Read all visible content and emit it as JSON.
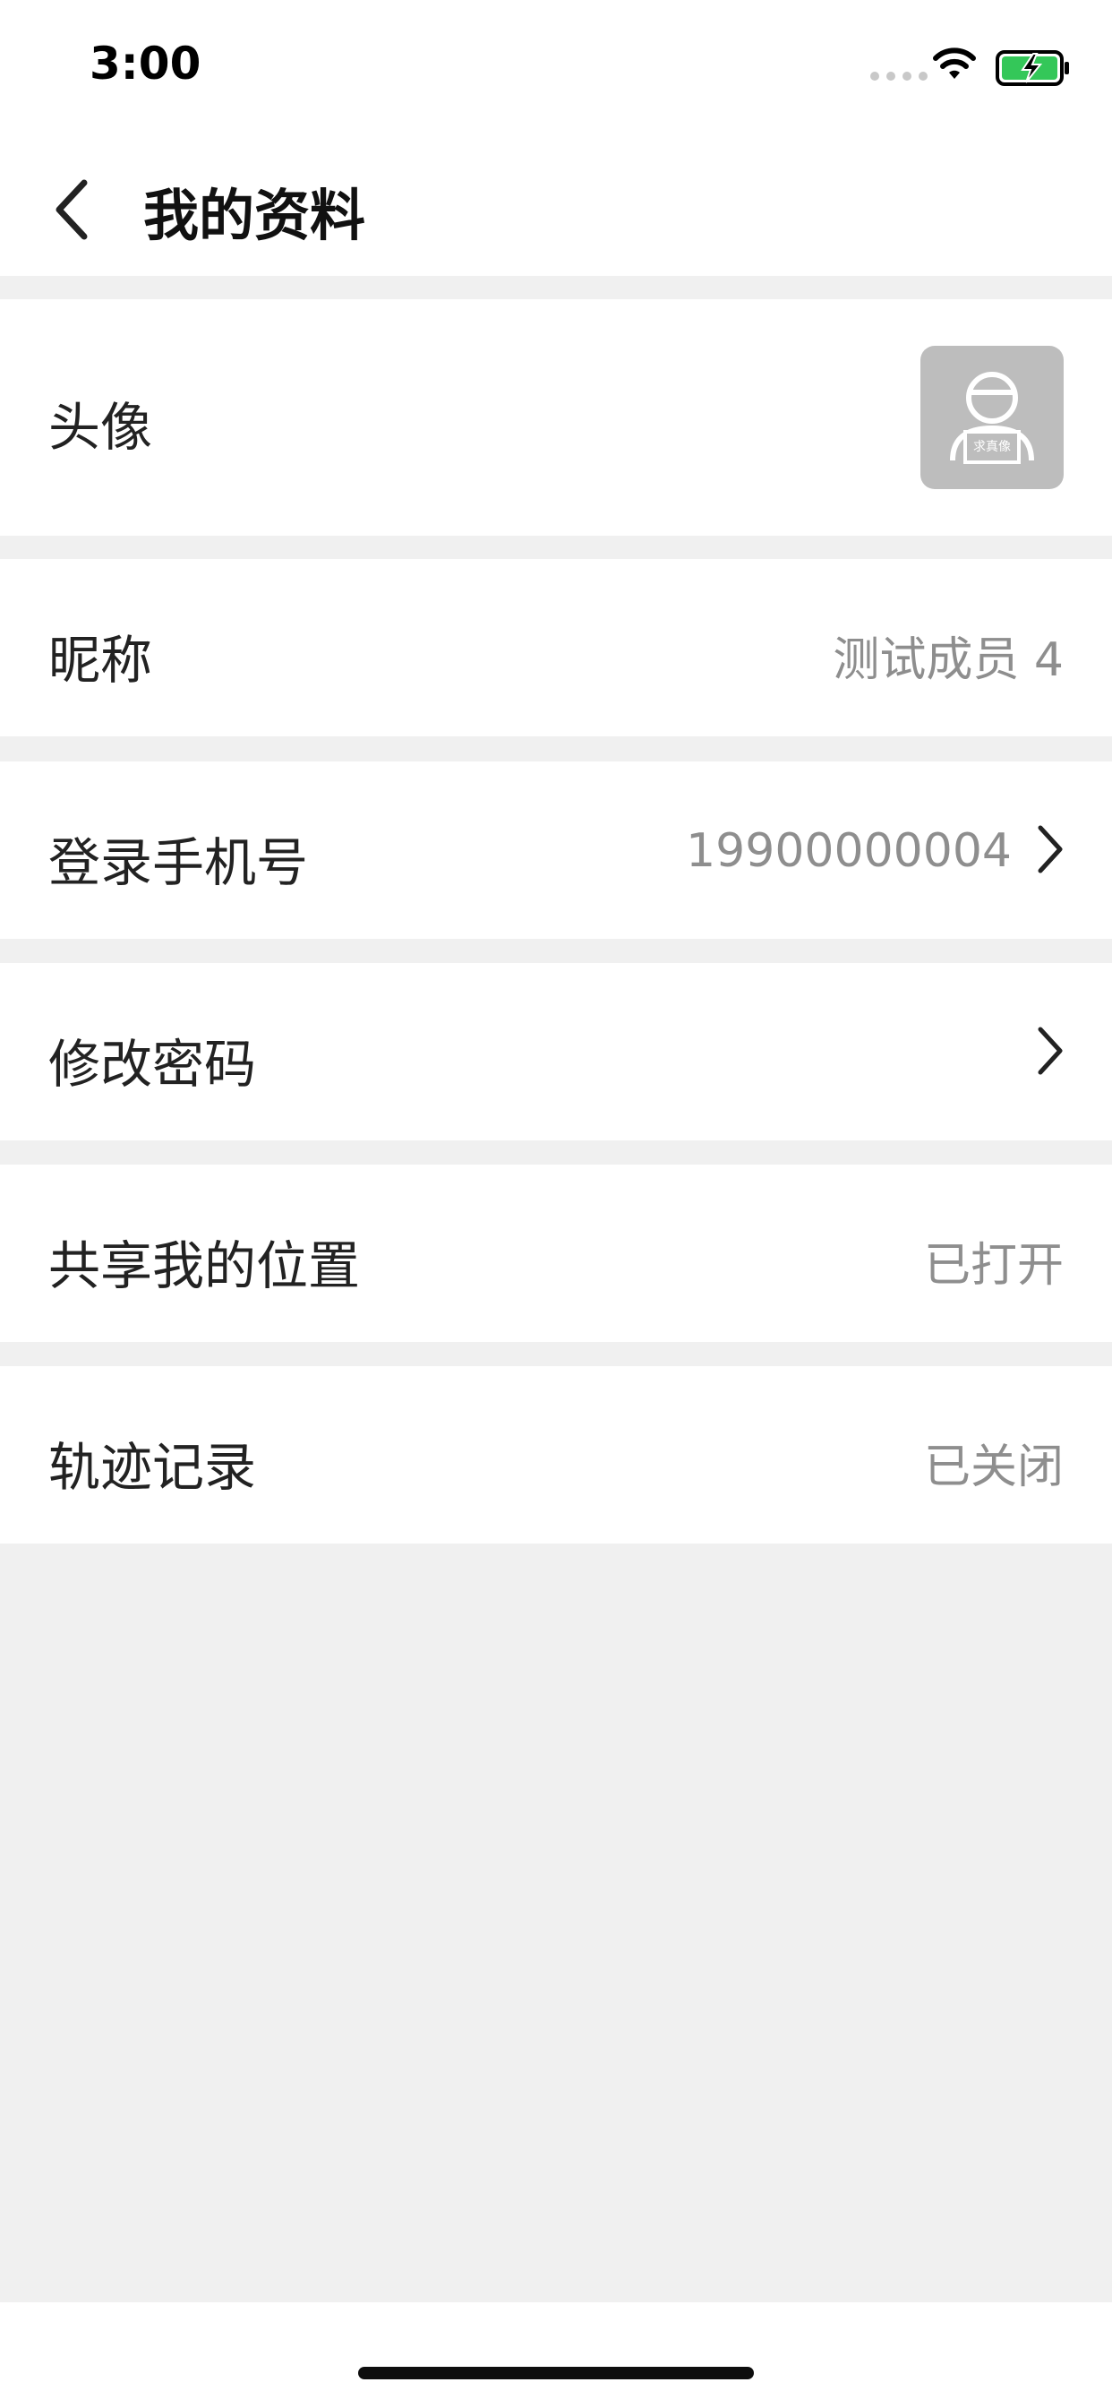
{
  "status_bar": {
    "time": "3:00",
    "icons": [
      "signal-dots-icon",
      "wifi-icon",
      "battery-charging-icon"
    ],
    "battery_color": "#34c759"
  },
  "nav": {
    "title": "我的资料",
    "back_icon": "chevron-left-icon"
  },
  "rows": [
    {
      "label": "头像",
      "kind": "avatar",
      "avatar_text": "求真像"
    },
    {
      "label": "昵称",
      "value": "测试成员 4"
    },
    {
      "label": "登录手机号",
      "value": "19900000004",
      "chevron": true
    },
    {
      "label": "修改密码",
      "value": "",
      "chevron": true
    },
    {
      "label": "共享我的位置",
      "value": "已打开"
    },
    {
      "label": "轨迹记录",
      "value": "已关闭"
    }
  ],
  "colors": {
    "page_bg": "#f0f0f0",
    "row_bg": "#ffffff",
    "value_text": "#8e8e8e"
  }
}
